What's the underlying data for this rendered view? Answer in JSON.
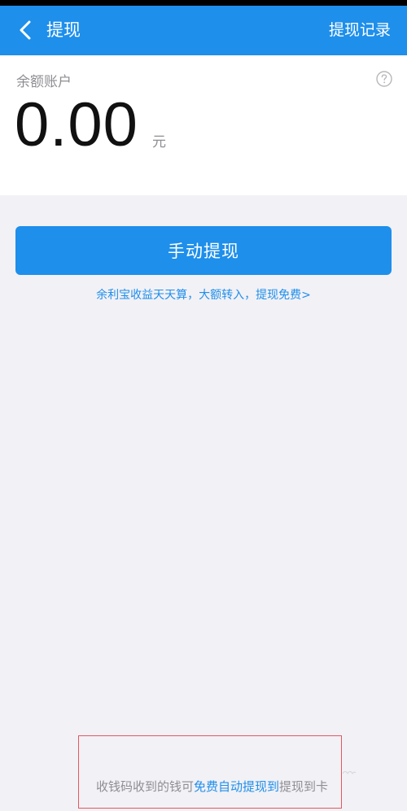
{
  "nav": {
    "title": "提现",
    "right_label": "提现记录"
  },
  "balance": {
    "label": "余额账户",
    "amount": "0.00",
    "unit": "元"
  },
  "actions": {
    "withdraw_label": "手动提现",
    "promo_text": "余利宝收益天天算，大额转入，提现免费>"
  },
  "footer": {
    "tip_prefix": "收钱码收到的钱可",
    "tip_link": "免费自动提现到",
    "tip_suffix": "提现到卡"
  },
  "colors": {
    "brand": "#1e8feb",
    "background": "#f2f1f6",
    "highlight_border": "#e0595f"
  },
  "icons": {
    "back": "chevron-left-icon",
    "help": "question-circle-icon"
  }
}
